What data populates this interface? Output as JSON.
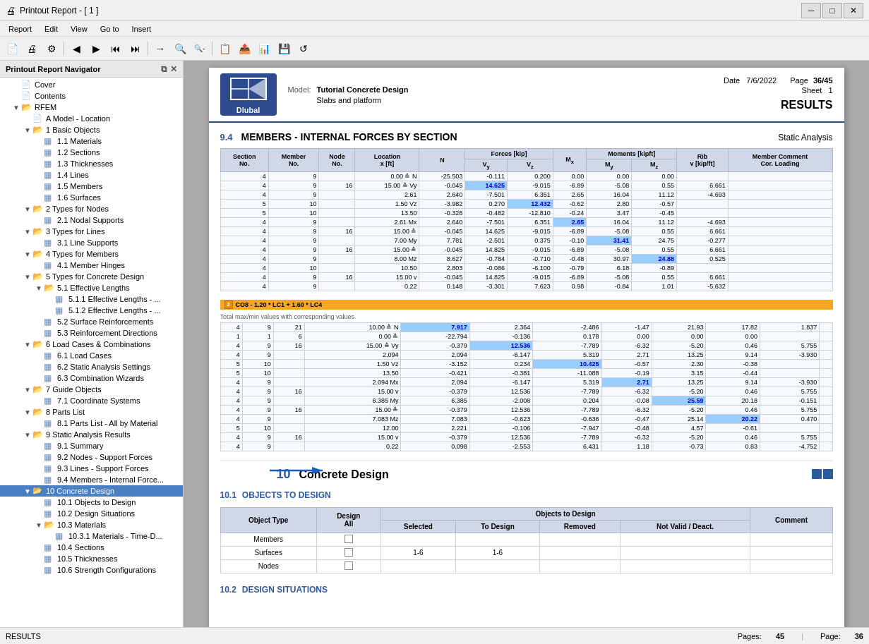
{
  "titleBar": {
    "title": "Printout Report - [ 1 ]",
    "icon": "🖨"
  },
  "menuBar": {
    "items": [
      "Report",
      "Edit",
      "View",
      "Go to",
      "Insert"
    ]
  },
  "toolbar": {
    "buttons": [
      "📄",
      "🖨",
      "⚙",
      "◀",
      "▶",
      "⏮",
      "⏭",
      "→",
      "🔍+",
      "🔍-",
      "📋",
      "📤",
      "📊",
      "💾",
      "↺"
    ]
  },
  "sidebar": {
    "title": "Printout Report Navigator",
    "items": [
      {
        "id": "cover",
        "label": "Cover",
        "level": 0,
        "type": "doc",
        "expanded": false
      },
      {
        "id": "contents",
        "label": "Contents",
        "level": 0,
        "type": "doc",
        "expanded": false
      },
      {
        "id": "rfem",
        "label": "RFEM",
        "level": 0,
        "type": "folder",
        "expanded": true
      },
      {
        "id": "model-location",
        "label": "A Model - Location",
        "level": 1,
        "type": "doc",
        "expanded": false
      },
      {
        "id": "basic-objects",
        "label": "1 Basic Objects",
        "level": 1,
        "type": "folder",
        "expanded": true
      },
      {
        "id": "materials",
        "label": "1.1 Materials",
        "level": 2,
        "type": "grid",
        "expanded": false
      },
      {
        "id": "sections",
        "label": "1.2 Sections",
        "level": 2,
        "type": "grid",
        "expanded": false
      },
      {
        "id": "thicknesses",
        "label": "1.3 Thicknesses",
        "level": 2,
        "type": "grid",
        "expanded": false
      },
      {
        "id": "lines",
        "label": "1.4 Lines",
        "level": 2,
        "type": "grid",
        "expanded": false
      },
      {
        "id": "members",
        "label": "1.5 Members",
        "level": 2,
        "type": "grid",
        "expanded": false
      },
      {
        "id": "surfaces",
        "label": "1.6 Surfaces",
        "level": 2,
        "type": "grid",
        "expanded": false
      },
      {
        "id": "types-nodes",
        "label": "2 Types for Nodes",
        "level": 1,
        "type": "folder",
        "expanded": true
      },
      {
        "id": "nodal-supports",
        "label": "2.1 Nodal Supports",
        "level": 2,
        "type": "grid",
        "expanded": false
      },
      {
        "id": "types-lines",
        "label": "3 Types for Lines",
        "level": 1,
        "type": "folder",
        "expanded": true
      },
      {
        "id": "line-supports",
        "label": "3.1 Line Supports",
        "level": 2,
        "type": "grid",
        "expanded": false
      },
      {
        "id": "types-members",
        "label": "4 Types for Members",
        "level": 1,
        "type": "folder",
        "expanded": true
      },
      {
        "id": "member-hinges",
        "label": "4.1 Member Hinges",
        "level": 2,
        "type": "grid",
        "expanded": false
      },
      {
        "id": "types-concrete",
        "label": "5 Types for Concrete Design",
        "level": 1,
        "type": "folder",
        "expanded": true
      },
      {
        "id": "effective-lengths",
        "label": "5.1 Effective Lengths",
        "level": 2,
        "type": "folder",
        "expanded": true
      },
      {
        "id": "eff-len-1",
        "label": "5.1.1 Effective Lengths - ...",
        "level": 3,
        "type": "grid",
        "expanded": false
      },
      {
        "id": "eff-len-2",
        "label": "5.1.2 Effective Lengths - ...",
        "level": 3,
        "type": "grid",
        "expanded": false
      },
      {
        "id": "surface-reinf",
        "label": "5.2 Surface Reinforcements",
        "level": 2,
        "type": "grid",
        "expanded": false
      },
      {
        "id": "reinf-dir",
        "label": "5.3 Reinforcement Directions",
        "level": 2,
        "type": "grid",
        "expanded": false
      },
      {
        "id": "load-cases",
        "label": "6 Load Cases & Combinations",
        "level": 1,
        "type": "folder",
        "expanded": true
      },
      {
        "id": "load-cases-list",
        "label": "6.1 Load Cases",
        "level": 2,
        "type": "grid",
        "expanded": false
      },
      {
        "id": "static-settings",
        "label": "6.2 Static Analysis Settings",
        "level": 2,
        "type": "grid",
        "expanded": false
      },
      {
        "id": "combo-wizards",
        "label": "6.3 Combination Wizards",
        "level": 2,
        "type": "grid",
        "expanded": false
      },
      {
        "id": "guide-objects",
        "label": "7 Guide Objects",
        "level": 1,
        "type": "folder",
        "expanded": true
      },
      {
        "id": "coord-systems",
        "label": "7.1 Coordinate Systems",
        "level": 2,
        "type": "grid",
        "expanded": false
      },
      {
        "id": "parts-list",
        "label": "8 Parts List",
        "level": 1,
        "type": "folder",
        "expanded": true
      },
      {
        "id": "parts-all",
        "label": "8.1 Parts List - All by Material",
        "level": 2,
        "type": "grid",
        "expanded": false
      },
      {
        "id": "static-results",
        "label": "9 Static Analysis Results",
        "level": 1,
        "type": "folder",
        "expanded": true
      },
      {
        "id": "summary",
        "label": "9.1 Summary",
        "level": 2,
        "type": "grid",
        "expanded": false
      },
      {
        "id": "nodes-support",
        "label": "9.2 Nodes - Support Forces",
        "level": 2,
        "type": "grid",
        "expanded": false
      },
      {
        "id": "lines-support",
        "label": "9.3 Lines - Support Forces",
        "level": 2,
        "type": "grid",
        "expanded": false
      },
      {
        "id": "members-internal",
        "label": "9.4 Members - Internal Force...",
        "level": 2,
        "type": "grid",
        "expanded": false
      },
      {
        "id": "concrete-design",
        "label": "10 Concrete Design",
        "level": 1,
        "type": "folder",
        "expanded": true,
        "selected": true
      },
      {
        "id": "objects-design",
        "label": "10.1 Objects to Design",
        "level": 2,
        "type": "grid",
        "expanded": false
      },
      {
        "id": "design-situations",
        "label": "10.2 Design Situations",
        "level": 2,
        "type": "grid",
        "expanded": false
      },
      {
        "id": "materials-10",
        "label": "10.3 Materials",
        "level": 2,
        "type": "folder",
        "expanded": true
      },
      {
        "id": "materials-time",
        "label": "10.3.1 Materials - Time-D...",
        "level": 3,
        "type": "grid",
        "expanded": false
      },
      {
        "id": "sections-10",
        "label": "10.4 Sections",
        "level": 2,
        "type": "grid",
        "expanded": false
      },
      {
        "id": "thicknesses-10",
        "label": "10.5 Thicknesses",
        "level": 2,
        "type": "grid",
        "expanded": false
      },
      {
        "id": "strength-configs",
        "label": "10.6 Strength Configurations",
        "level": 2,
        "type": "grid",
        "expanded": false
      }
    ]
  },
  "report": {
    "header": {
      "modelLabel": "Model:",
      "modelName": "Tutorial Concrete Design",
      "projectLabel": "Slabs and platform",
      "dateLabel": "Date",
      "dateValue": "7/6/2022",
      "pageLabel": "Page",
      "pageValue": "36/45",
      "sheetLabel": "Sheet",
      "sheetValue": "1",
      "sectionTitle": "RESULTS"
    },
    "section94": {
      "num": "9.4",
      "title": "MEMBERS - INTERNAL FORCES BY SECTION",
      "subtitle": "Static Analysis",
      "tableHeaders": [
        "Section No.",
        "Member No.",
        "Node No.",
        "Location x [ft]",
        "N",
        "Forces [kip] Vy",
        "Vz",
        "Mx",
        "Moments [kipft] My",
        "Mz",
        "Rib v [kip/ft]",
        "Member Comment Cor. Loading"
      ],
      "rows": [
        {
          "sec": "4",
          "mem": "9",
          "node": "",
          "loc": "0.00 ≙ N",
          "n": "-25.503",
          "vy": "-0.111",
          "vz": "0.200",
          "mx": "0.00",
          "my": "0.00",
          "mz": "0.00",
          "rib": "",
          "highlight": ""
        },
        {
          "sec": "4",
          "mem": "9",
          "node": "16",
          "loc": "15.00 ≙ Vy",
          "n": "-0.045",
          "vy": "14.625",
          "vz": "-9.015",
          "mx": "-6.89",
          "my": "-5.08",
          "mz": "0.55",
          "rib": "6.661",
          "highlight": "vy"
        },
        {
          "sec": "4",
          "mem": "9",
          "node": "",
          "loc": "2.61",
          "n": "2.640",
          "vy": "-7.501",
          "vz": "6.351",
          "mx": "2.65",
          "my": "16.04",
          "mz": "11.12",
          "rib": "-4.693",
          "highlight": ""
        },
        {
          "sec": "5",
          "mem": "10",
          "node": "",
          "loc": "1.50 Vz",
          "n": "-3.982",
          "vy": "0.270",
          "vz": "12.432",
          "mx": "-0.62",
          "my": "2.80",
          "mz": "-0.57",
          "rib": "",
          "highlight": "vz"
        },
        {
          "sec": "5",
          "mem": "10",
          "node": "",
          "loc": "13.50",
          "n": "-0.328",
          "vy": "-0.482",
          "vz": "-12.810",
          "mx": "-0.24",
          "my": "3.47",
          "mz": "-0.45",
          "rib": "",
          "highlight": ""
        },
        {
          "sec": "4",
          "mem": "9",
          "node": "",
          "loc": "2.61 Mx",
          "n": "2.640",
          "vy": "-7.501",
          "vz": "6.351",
          "mx": "2.65",
          "my": "16.04",
          "mz": "11.12",
          "rib": "-4.693",
          "highlight": "mx"
        },
        {
          "sec": "4",
          "mem": "9",
          "node": "16",
          "loc": "15.00 ≙",
          "n": "-0.045",
          "vy": "14.625",
          "vz": "-9.015",
          "mx": "-6.89",
          "my": "-5.08",
          "mz": "0.55",
          "rib": "6.661",
          "highlight": ""
        },
        {
          "sec": "4",
          "mem": "9",
          "node": "",
          "loc": "7.00 My",
          "n": "7.781",
          "vy": "-2.501",
          "vz": "0.375",
          "mx": "-0.10",
          "my": "31.41",
          "mz": "24.75",
          "rib": "-0.277",
          "highlight": "my"
        },
        {
          "sec": "4",
          "mem": "9",
          "node": "16",
          "loc": "15.00 ≙",
          "n": "-0.045",
          "vy": "14.825",
          "vz": "-9.015",
          "mx": "-6.89",
          "my": "-5.08",
          "mz": "0.55",
          "rib": "6.661",
          "highlight": ""
        },
        {
          "sec": "4",
          "mem": "9",
          "node": "",
          "loc": "8.00 Mz",
          "n": "8.627",
          "vy": "-0.784",
          "vz": "-0.710",
          "mx": "-0.48",
          "my": "30.97",
          "mz": "24.88",
          "rib": "0.525",
          "highlight": "mz"
        },
        {
          "sec": "4",
          "mem": "10",
          "node": "",
          "loc": "10.50",
          "n": "2.803",
          "vy": "-0.086",
          "vz": "-6.100",
          "mx": "-0.79",
          "my": "6.18",
          "mz": "-0.89",
          "rib": "",
          "highlight": ""
        },
        {
          "sec": "4",
          "mem": "9",
          "node": "16",
          "loc": "15.00 v",
          "n": "-0.045",
          "vy": "14.825",
          "vz": "-9.015",
          "mx": "-6.89",
          "my": "-5.08",
          "mz": "0.55",
          "rib": "6.661",
          "highlight": ""
        },
        {
          "sec": "4",
          "mem": "9",
          "node": "",
          "loc": "0.22",
          "n": "0.148",
          "vy": "-3.301",
          "vz": "7.623",
          "mx": "0.98",
          "my": "-0.84",
          "mz": "1.01",
          "rib": "-5.632",
          "highlight": ""
        }
      ],
      "comboBar": {
        "num": "2",
        "label": "CO8 - 1.20 * LC1 + 1.60 * LC4",
        "subLabel": "Total max/min values with corresponding values"
      },
      "comboRows": [
        {
          "sec": "4",
          "mem": "9",
          "node": "21",
          "loc": "10.00 ≙ N",
          "n": "7.917",
          "vy": "2.364",
          "vz": "-2.486",
          "mx": "-1.47",
          "my": "21.93",
          "mz": "17.82",
          "rib": "1.837",
          "highlight": "n"
        },
        {
          "sec": "1",
          "mem": "1",
          "node": "6",
          "loc": "0.00 ≙",
          "n": "-22.794",
          "vy": "-0.136",
          "vz": "0.178",
          "mx": "0.00",
          "my": "0.00",
          "mz": "0.00",
          "rib": "",
          "highlight": ""
        },
        {
          "sec": "4",
          "mem": "9",
          "node": "16",
          "loc": "15.00 ≙ Vy",
          "n": "-0.379",
          "vy": "12.536",
          "vz": "-7.789",
          "mx": "-6.32",
          "my": "-5.20",
          "mz": "0.46",
          "rib": "5.755",
          "highlight": "vy"
        },
        {
          "sec": "4",
          "mem": "9",
          "node": "",
          "loc": "2.094",
          "n": "2.094",
          "vy": "-6.147",
          "vz": "5.319",
          "mx": "2.71",
          "my": "13.25",
          "mz": "9.14",
          "rib": "-3.930",
          "highlight": ""
        },
        {
          "sec": "5",
          "mem": "10",
          "node": "",
          "loc": "1.50 Vz",
          "n": "-3.152",
          "vy": "0.234",
          "vz": "10.425",
          "mx": "-0.57",
          "my": "2.30",
          "mz": "-0.38",
          "rib": "",
          "highlight": "vz"
        },
        {
          "sec": "5",
          "mem": "10",
          "node": "",
          "loc": "13.50",
          "n": "-0.421",
          "vy": "-0.381",
          "vz": "-11.088",
          "mx": "-0.19",
          "my": "3.15",
          "mz": "-0.44",
          "rib": "",
          "highlight": ""
        },
        {
          "sec": "4",
          "mem": "9",
          "node": "",
          "loc": "2.094 Mx",
          "n": "2.094",
          "vy": "-6.147",
          "vz": "5.319",
          "mx": "2.71",
          "my": "13.25",
          "mz": "9.14",
          "rib": "-3.930",
          "highlight": "mx"
        },
        {
          "sec": "4",
          "mem": "9",
          "node": "16",
          "loc": "15.00 v",
          "n": "-0.379",
          "vy": "12.536",
          "vz": "-7.789",
          "mx": "-6.32",
          "my": "-5.20",
          "mz": "0.46",
          "rib": "5.755",
          "highlight": ""
        },
        {
          "sec": "4",
          "mem": "9",
          "node": "",
          "loc": "6.385 My",
          "n": "6.385",
          "vy": "-2.008",
          "vz": "0.204",
          "mx": "-0.08",
          "my": "25.59",
          "mz": "20.18",
          "rib": "-0.151",
          "highlight": "my"
        },
        {
          "sec": "4",
          "mem": "9",
          "node": "16",
          "loc": "15.00 ≙",
          "n": "-0.379",
          "vy": "12.536",
          "vz": "-7.789",
          "mx": "-6.32",
          "my": "-5.20",
          "mz": "0.46",
          "rib": "5.755",
          "highlight": ""
        },
        {
          "sec": "4",
          "mem": "9",
          "node": "",
          "loc": "7.083 Mz",
          "n": "7.083",
          "vy": "-0.623",
          "vz": "-0.636",
          "mx": "-0.47",
          "my": "25.14",
          "mz": "20.22",
          "rib": "0.470",
          "highlight": "mz"
        },
        {
          "sec": "5",
          "mem": "10",
          "node": "",
          "loc": "12.00",
          "n": "2.221",
          "vy": "-0.106",
          "vz": "-7.947",
          "mx": "-0.48",
          "my": "4.57",
          "mz": "-0.61",
          "rib": "",
          "highlight": ""
        },
        {
          "sec": "4",
          "mem": "9",
          "node": "16",
          "loc": "15.00 v",
          "n": "-0.379",
          "vy": "12.536",
          "vz": "-7.789",
          "mx": "-6.32",
          "my": "-5.20",
          "mz": "0.46",
          "rib": "5.755",
          "highlight": ""
        },
        {
          "sec": "4",
          "mem": "9",
          "node": "",
          "loc": "0.22",
          "n": "0.098",
          "vy": "-2.553",
          "vz": "6.431",
          "mx": "1.18",
          "my": "-0.73",
          "mz": "0.83",
          "rib": "-4.752",
          "highlight": ""
        }
      ]
    },
    "section10": {
      "num": "10",
      "title": "Concrete Design",
      "subsection101": {
        "num": "10.1",
        "title": "OBJECTS TO DESIGN",
        "tableHeaders": [
          "Object Type",
          "Design All",
          "Selected",
          "To Design",
          "Removed",
          "Not Valid / Deact.",
          "Comment"
        ],
        "rows": [
          {
            "type": "Members",
            "all": false,
            "selected": "",
            "toDesign": "",
            "removed": "",
            "notValid": ""
          },
          {
            "type": "Surfaces",
            "all": false,
            "selected": "1-6",
            "toDesign": "1-6",
            "removed": "",
            "notValid": ""
          },
          {
            "type": "Nodes",
            "all": false,
            "selected": "",
            "toDesign": "",
            "removed": "",
            "notValid": ""
          }
        ]
      },
      "subsection102": {
        "num": "10.2",
        "title": "DESIGN SITUATIONS"
      }
    }
  },
  "statusBar": {
    "status": "RESULTS",
    "pagesLabel": "Pages:",
    "pagesValue": "45",
    "pageLabel": "Page:",
    "pageValue": "36"
  }
}
